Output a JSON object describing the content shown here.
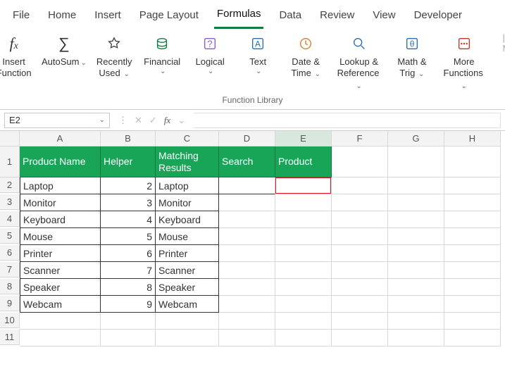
{
  "tabs": [
    "File",
    "Home",
    "Insert",
    "Page Layout",
    "Formulas",
    "Data",
    "Review",
    "View",
    "Developer"
  ],
  "active_tab": "Formulas",
  "ribbon": {
    "insert_function": "Insert\nFunction",
    "autosum": "AutoSum",
    "recently": "Recently\nUsed",
    "financial": "Financial",
    "logical": "Logical",
    "text": "Text",
    "datetime": "Date &\nTime",
    "lookup": "Lookup &\nReference",
    "math": "Math &\nTrig",
    "more": "More\nFunctions",
    "group_label": "Function Library",
    "edge_letter": "M"
  },
  "namebox": "E2",
  "fx_label": "fx",
  "columns": [
    "A",
    "B",
    "C",
    "D",
    "E",
    "F",
    "G",
    "H"
  ],
  "selected_col": "E",
  "row_numbers": [
    "1",
    "2",
    "3",
    "4",
    "5",
    "6",
    "7",
    "8",
    "9",
    "10",
    "11"
  ],
  "headers": {
    "A": "Product Name",
    "B": "Helper",
    "C": "Matching Results",
    "D": "Search",
    "E": "Product"
  },
  "rows": [
    {
      "a": "Laptop",
      "b": "2",
      "c": "Laptop"
    },
    {
      "a": "Monitor",
      "b": "3",
      "c": "Monitor"
    },
    {
      "a": "Keyboard",
      "b": "4",
      "c": "Keyboard"
    },
    {
      "a": "Mouse",
      "b": "5",
      "c": "Mouse"
    },
    {
      "a": "Printer",
      "b": "6",
      "c": "Printer"
    },
    {
      "a": "Scanner",
      "b": "7",
      "c": "Scanner"
    },
    {
      "a": "Speaker",
      "b": "8",
      "c": "Speaker"
    },
    {
      "a": "Webcam",
      "b": "9",
      "c": "Webcam"
    }
  ]
}
